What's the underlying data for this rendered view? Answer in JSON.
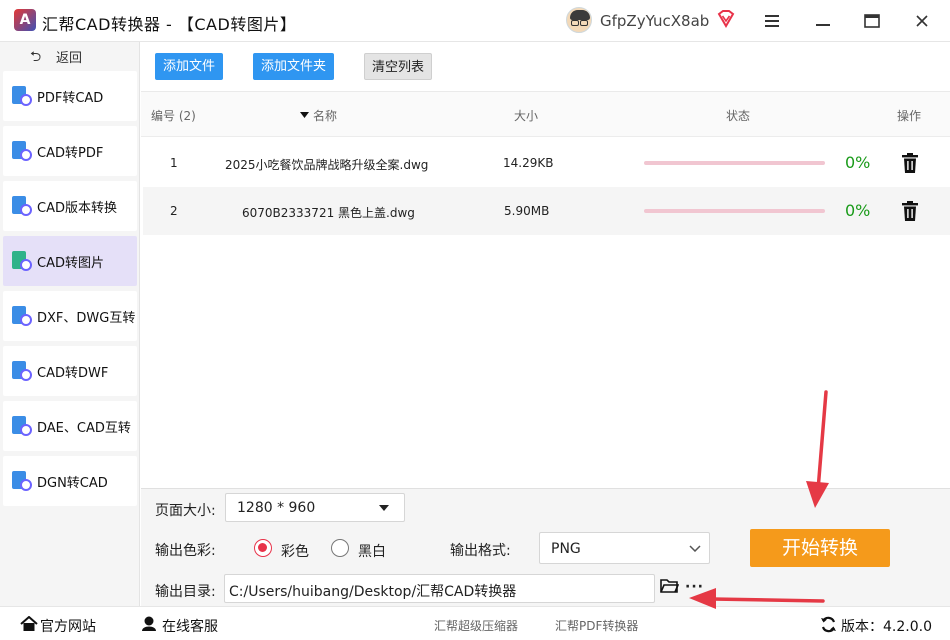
{
  "window": {
    "title": "汇帮CAD转换器 - 【CAD转图片】",
    "logo_letter": "A",
    "username": "GfpZyYucX8ab"
  },
  "sidebar": {
    "back_label": "返回",
    "items": [
      {
        "label": "PDF转CAD"
      },
      {
        "label": "CAD转PDF"
      },
      {
        "label": "CAD版本转换"
      },
      {
        "label": "CAD转图片",
        "active": true
      },
      {
        "label": "DXF、DWG互转"
      },
      {
        "label": "CAD转DWF"
      },
      {
        "label": "DAE、CAD互转"
      },
      {
        "label": "DGN转CAD"
      }
    ]
  },
  "toolbar": {
    "add_file": "添加文件",
    "add_folder": "添加文件夹",
    "clear_list": "清空列表"
  },
  "table": {
    "headers": {
      "index": "编号 (2)",
      "name": "名称",
      "size": "大小",
      "status": "状态",
      "action": "操作"
    },
    "rows": [
      {
        "index": "1",
        "name": "2025小吃餐饮品牌战略升级全案.dwg",
        "size": "14.29KB",
        "progress": 0,
        "percent": "0%"
      },
      {
        "index": "2",
        "name": "6070B2333721 黑色上盖.dwg",
        "size": "5.90MB",
        "progress": 0,
        "percent": "0%"
      }
    ]
  },
  "settings": {
    "page_size_label": "页面大小:",
    "page_size_value": "1280 * 960",
    "color_label": "输出色彩:",
    "color_option_color": "彩色",
    "color_option_bw": "黑白",
    "format_label": "输出格式:",
    "format_value": "PNG",
    "dir_label": "输出目录:",
    "dir_value": "C:/Users/huibang/Desktop/汇帮CAD转换器",
    "more_label": "···",
    "start_button": "开始转换"
  },
  "statusbar": {
    "website": "官方网站",
    "support": "在线客服",
    "link_compress": "汇帮超级压缩器",
    "link_pdf": "汇帮PDF转换器",
    "version": "版本：4.2.0.0"
  },
  "colors": {
    "accent_blue": "#2f96f1",
    "start_orange": "#f59a1b",
    "progress_pink": "#f1c6d1",
    "percent_green": "#1a9b1a",
    "radio_red": "#e8334a",
    "annotation_red": "#e53945"
  }
}
